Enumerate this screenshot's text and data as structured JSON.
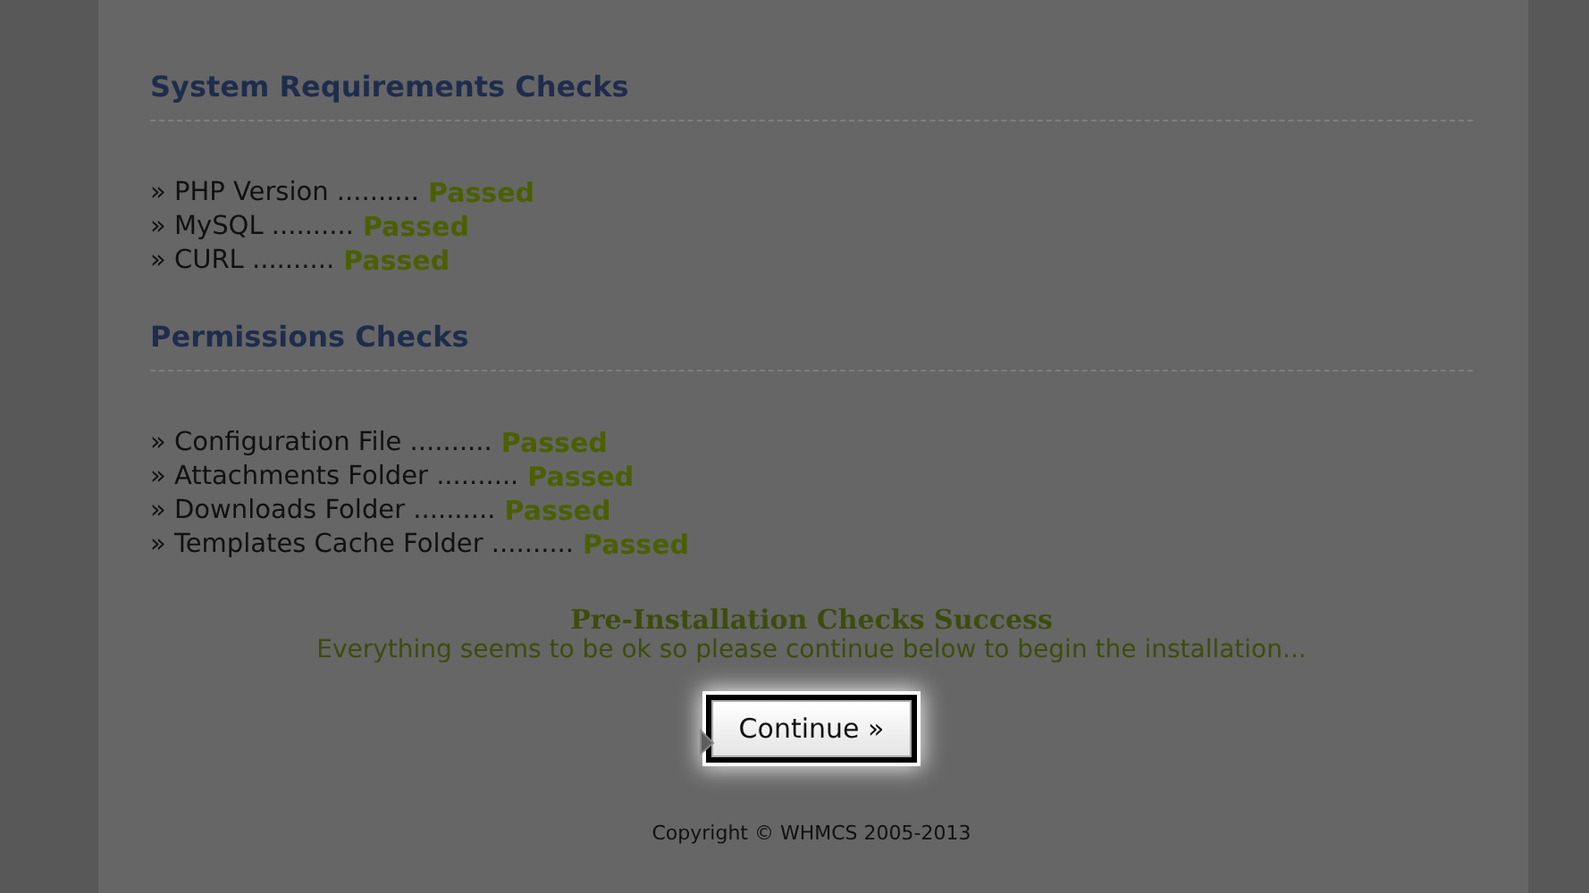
{
  "sections": [
    {
      "title": "System Requirements Checks",
      "checks": [
        {
          "label": "» PHP Version ..........",
          "result": "Passed"
        },
        {
          "label": "» MySQL ..........",
          "result": "Passed"
        },
        {
          "label": "» CURL ..........",
          "result": "Passed"
        }
      ]
    },
    {
      "title": "Permissions Checks",
      "checks": [
        {
          "label": "» Configuration File ..........",
          "result": "Passed"
        },
        {
          "label": "» Attachments Folder ..........",
          "result": "Passed"
        },
        {
          "label": "» Downloads Folder ..........",
          "result": "Passed"
        },
        {
          "label": "» Templates Cache Folder ..........",
          "result": "Passed"
        }
      ]
    }
  ],
  "summary": {
    "title": "Pre-Installation Checks Success",
    "message": "Everything seems to be ok so please continue below to begin the installation..."
  },
  "continue_button": "Continue »",
  "footer": "Copyright © WHMCS 2005-2013"
}
